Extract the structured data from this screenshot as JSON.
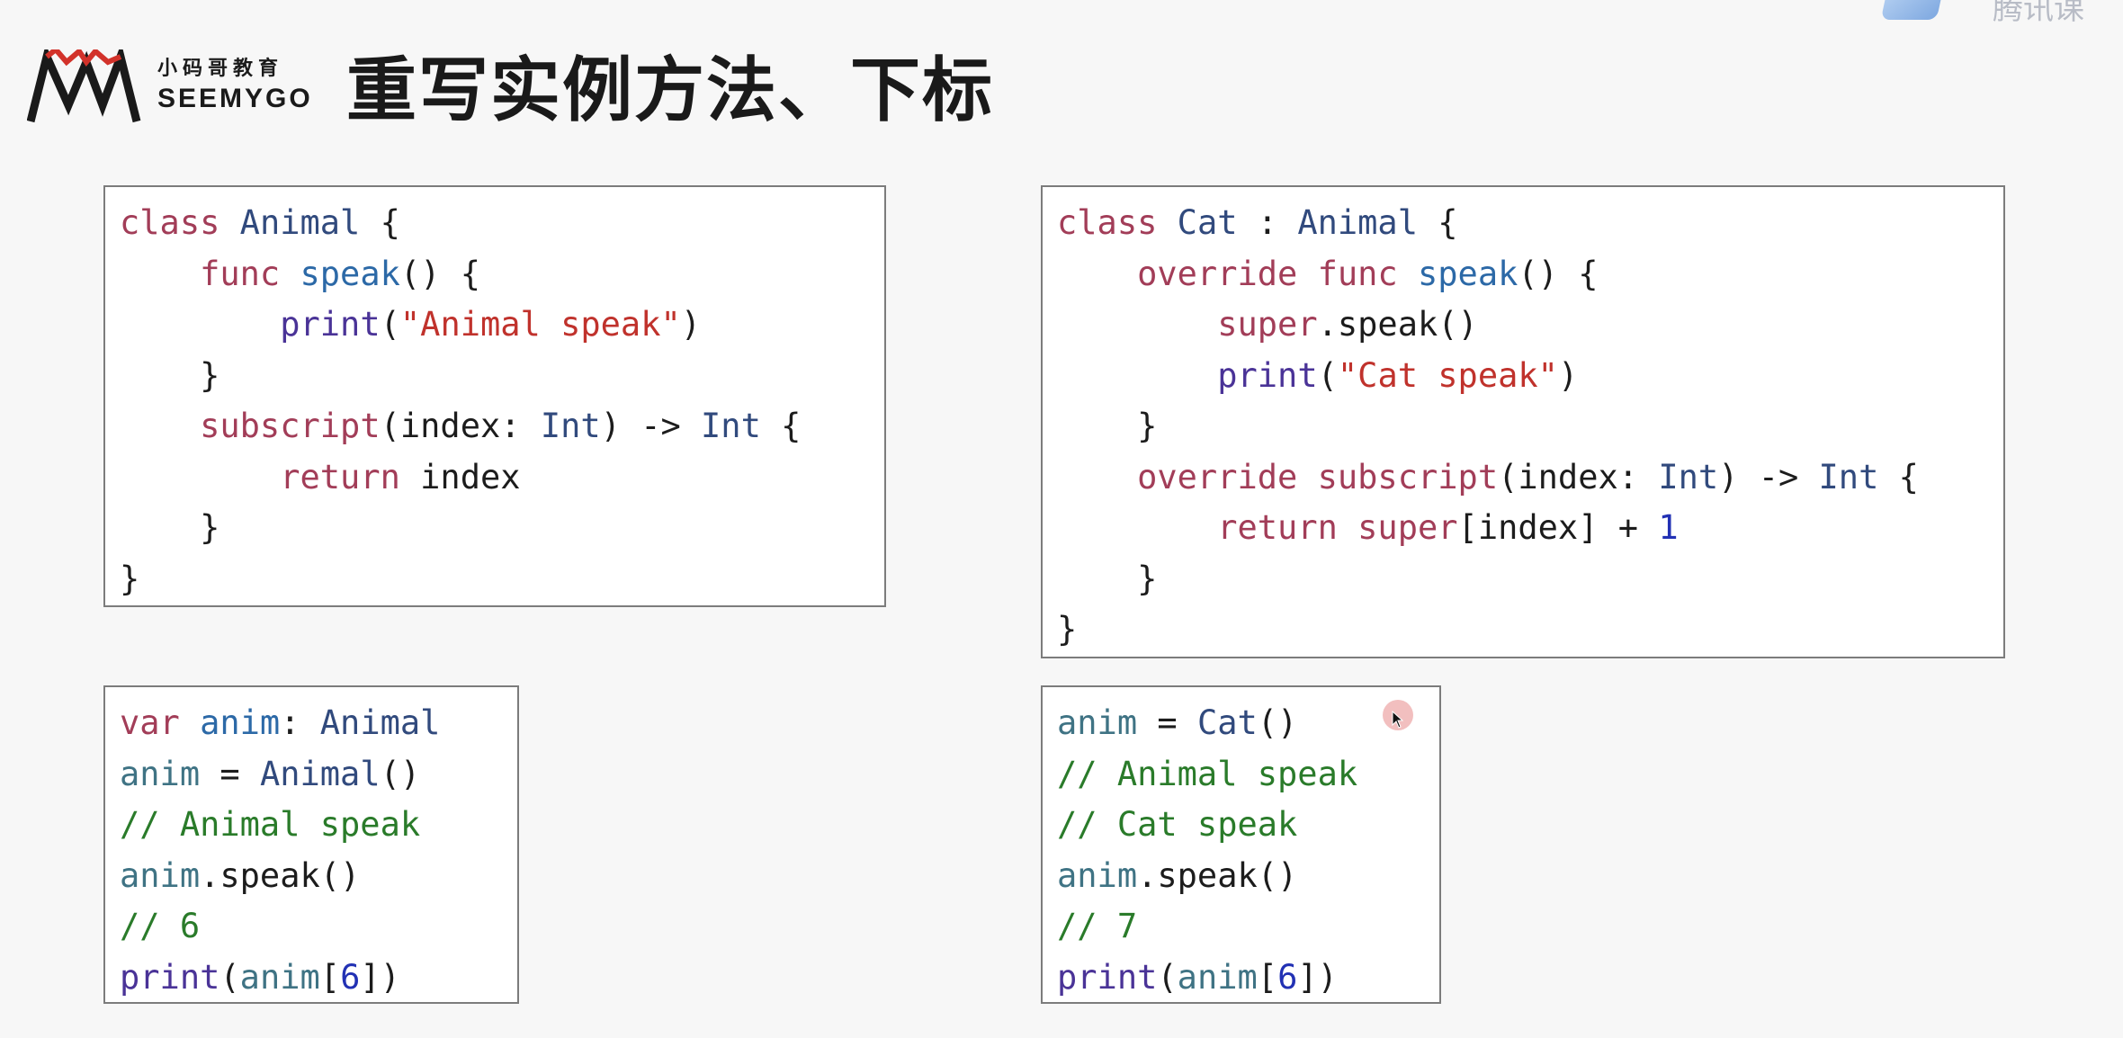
{
  "brand": {
    "name_cn": "小码哥教育",
    "name_en": "SEEMYGO",
    "logo_icon": "mj-mountain-logo-icon"
  },
  "slide": {
    "title": "重写实例方法、下标"
  },
  "corner": {
    "icon": "video-app-icon",
    "text": "腾讯课"
  },
  "colors": {
    "keyword": "#a23d58",
    "type": "#314a7d",
    "function": "#2c69a7",
    "library_function": "#4a3397",
    "string": "#c0322c",
    "number": "#2231b4",
    "variable": "#3f7384",
    "comment": "#2a7b2a",
    "plain": "#1c1c1c"
  },
  "code_blocks": {
    "animal_class": [
      [
        [
          "kw",
          "class"
        ],
        [
          "pl",
          " "
        ],
        [
          "ty",
          "Animal"
        ],
        [
          "pl",
          " {"
        ]
      ],
      [
        [
          "pl",
          "    "
        ],
        [
          "kw",
          "func"
        ],
        [
          "pl",
          " "
        ],
        [
          "fn",
          "speak"
        ],
        [
          "pl",
          "() {"
        ]
      ],
      [
        [
          "pl",
          "        "
        ],
        [
          "lib",
          "print"
        ],
        [
          "pl",
          "("
        ],
        [
          "str",
          "\"Animal speak\""
        ],
        [
          "pl",
          ")"
        ]
      ],
      [
        [
          "pl",
          "    }"
        ]
      ],
      [
        [
          "pl",
          "    "
        ],
        [
          "kw",
          "subscript"
        ],
        [
          "pl",
          "(index: "
        ],
        [
          "ty",
          "Int"
        ],
        [
          "pl",
          ") -> "
        ],
        [
          "ty",
          "Int"
        ],
        [
          "pl",
          " {"
        ]
      ],
      [
        [
          "pl",
          "        "
        ],
        [
          "kw",
          "return"
        ],
        [
          "pl",
          " index"
        ]
      ],
      [
        [
          "pl",
          "    }"
        ]
      ],
      [
        [
          "pl",
          "}"
        ]
      ]
    ],
    "cat_class": [
      [
        [
          "kw",
          "class"
        ],
        [
          "pl",
          " "
        ],
        [
          "ty",
          "Cat"
        ],
        [
          "pl",
          " : "
        ],
        [
          "ty",
          "Animal"
        ],
        [
          "pl",
          " {"
        ]
      ],
      [
        [
          "pl",
          "    "
        ],
        [
          "kw",
          "override"
        ],
        [
          "pl",
          " "
        ],
        [
          "kw",
          "func"
        ],
        [
          "pl",
          " "
        ],
        [
          "fn",
          "speak"
        ],
        [
          "pl",
          "() {"
        ]
      ],
      [
        [
          "pl",
          "        "
        ],
        [
          "kw",
          "super"
        ],
        [
          "pl",
          ".speak()"
        ]
      ],
      [
        [
          "pl",
          "        "
        ],
        [
          "lib",
          "print"
        ],
        [
          "pl",
          "("
        ],
        [
          "str",
          "\"Cat speak\""
        ],
        [
          "pl",
          ")"
        ]
      ],
      [
        [
          "pl",
          "    }"
        ]
      ],
      [
        [
          "pl",
          "    "
        ],
        [
          "kw",
          "override"
        ],
        [
          "pl",
          " "
        ],
        [
          "kw",
          "subscript"
        ],
        [
          "pl",
          "(index: "
        ],
        [
          "ty",
          "Int"
        ],
        [
          "pl",
          ") -> "
        ],
        [
          "ty",
          "Int"
        ],
        [
          "pl",
          " {"
        ]
      ],
      [
        [
          "pl",
          "        "
        ],
        [
          "kw",
          "return"
        ],
        [
          "pl",
          " "
        ],
        [
          "kw",
          "super"
        ],
        [
          "pl",
          "[index] + "
        ],
        [
          "num",
          "1"
        ]
      ],
      [
        [
          "pl",
          "    }"
        ]
      ],
      [
        [
          "pl",
          "}"
        ]
      ]
    ],
    "usage_animal": [
      [
        [
          "kw",
          "var"
        ],
        [
          "pl",
          " "
        ],
        [
          "fn",
          "anim"
        ],
        [
          "pl",
          ": "
        ],
        [
          "ty",
          "Animal"
        ]
      ],
      [
        [
          "var",
          "anim"
        ],
        [
          "pl",
          " = "
        ],
        [
          "ty",
          "Animal"
        ],
        [
          "pl",
          "()"
        ]
      ],
      [
        [
          "cmt",
          "// Animal speak"
        ]
      ],
      [
        [
          "var",
          "anim"
        ],
        [
          "pl",
          ".speak()"
        ]
      ],
      [
        [
          "cmt",
          "// 6"
        ]
      ],
      [
        [
          "lib",
          "print"
        ],
        [
          "pl",
          "("
        ],
        [
          "var",
          "anim"
        ],
        [
          "pl",
          "["
        ],
        [
          "num",
          "6"
        ],
        [
          "pl",
          "])"
        ]
      ]
    ],
    "usage_cat": [
      [
        [
          "var",
          "anim"
        ],
        [
          "pl",
          " = "
        ],
        [
          "ty",
          "Cat"
        ],
        [
          "pl",
          "()"
        ]
      ],
      [
        [
          "cmt",
          "// Animal speak"
        ]
      ],
      [
        [
          "cmt",
          "// Cat speak"
        ]
      ],
      [
        [
          "var",
          "anim"
        ],
        [
          "pl",
          ".speak()"
        ]
      ],
      [
        [
          "cmt",
          "// 7"
        ]
      ],
      [
        [
          "lib",
          "print"
        ],
        [
          "pl",
          "("
        ],
        [
          "var",
          "anim"
        ],
        [
          "pl",
          "["
        ],
        [
          "num",
          "6"
        ],
        [
          "pl",
          "])"
        ]
      ]
    ]
  },
  "pointer": {
    "icon": "mouse-pointer-icon"
  }
}
